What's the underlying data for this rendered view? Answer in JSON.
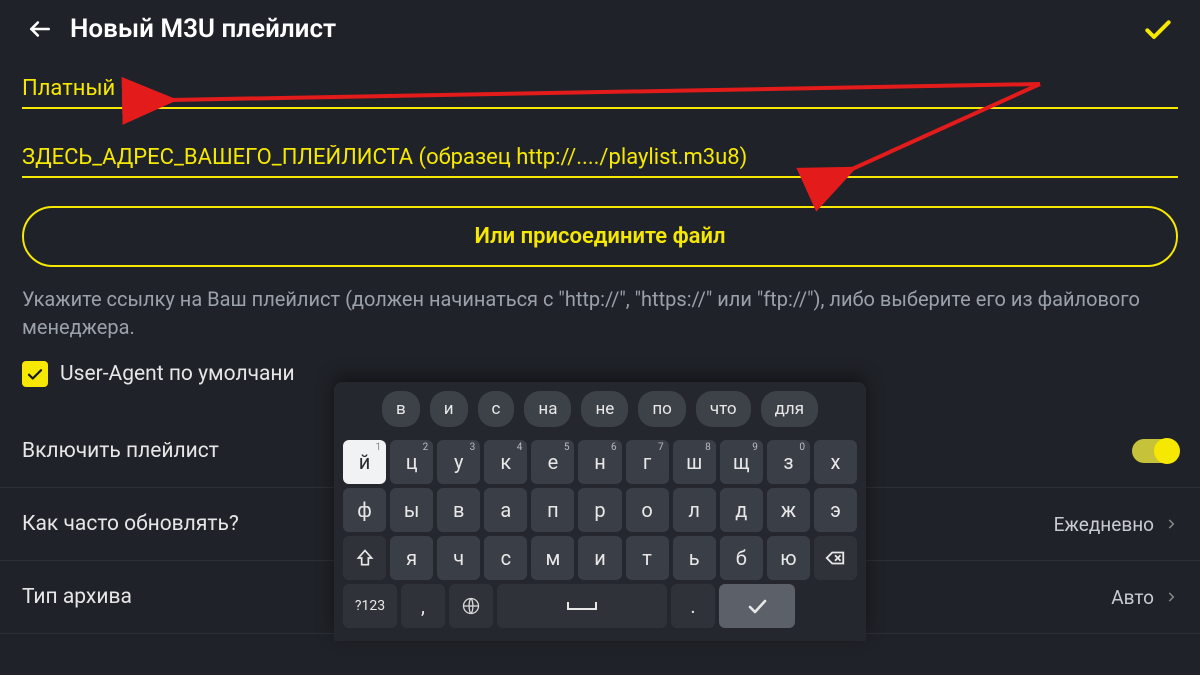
{
  "header": {
    "title": "Новый M3U плейлист"
  },
  "fields": {
    "name_value": "Платный",
    "url_placeholder": "ЗДЕСЬ_АДРЕС_ВАШЕГО_ПЛЕЙЛИСТА (образец http://..../playlist.m3u8)"
  },
  "attach_button": "Или присоедините файл",
  "hint": "Укажите ссылку на Ваш плейлист (должен начинаться с \"http://\", \"https://\" или \"ftp://\"), либо выберите его из файлового менеджера.",
  "user_agent": {
    "label": "User-Agent по умолчани",
    "checked": true
  },
  "rows": {
    "enable": {
      "label": "Включить плейлист",
      "value_on": true
    },
    "update": {
      "label": "Как часто обновлять?",
      "value": "Ежедневно"
    },
    "archive": {
      "label": "Тип архива",
      "value": "Авто"
    }
  },
  "keyboard": {
    "suggestions": [
      "в",
      "и",
      "с",
      "на",
      "не",
      "по",
      "что",
      "для"
    ],
    "row1": [
      {
        "k": "й",
        "s": "1",
        "light": true
      },
      {
        "k": "ц",
        "s": "2"
      },
      {
        "k": "у",
        "s": "3"
      },
      {
        "k": "к",
        "s": "4"
      },
      {
        "k": "е",
        "s": "5"
      },
      {
        "k": "н",
        "s": "6"
      },
      {
        "k": "г",
        "s": "7"
      },
      {
        "k": "ш",
        "s": "8"
      },
      {
        "k": "щ",
        "s": "9"
      },
      {
        "k": "з",
        "s": "0"
      },
      {
        "k": "х"
      }
    ],
    "row2": [
      {
        "k": "ф"
      },
      {
        "k": "ы"
      },
      {
        "k": "в"
      },
      {
        "k": "а"
      },
      {
        "k": "п"
      },
      {
        "k": "р"
      },
      {
        "k": "о"
      },
      {
        "k": "л"
      },
      {
        "k": "д"
      },
      {
        "k": "ж"
      },
      {
        "k": "э"
      }
    ],
    "row3": [
      {
        "k": "я"
      },
      {
        "k": "ч"
      },
      {
        "k": "с"
      },
      {
        "k": "м"
      },
      {
        "k": "и"
      },
      {
        "k": "т"
      },
      {
        "k": "ь"
      },
      {
        "k": "б"
      },
      {
        "k": "ю"
      }
    ],
    "sym": "?123",
    "comma": ",",
    "period": "."
  }
}
